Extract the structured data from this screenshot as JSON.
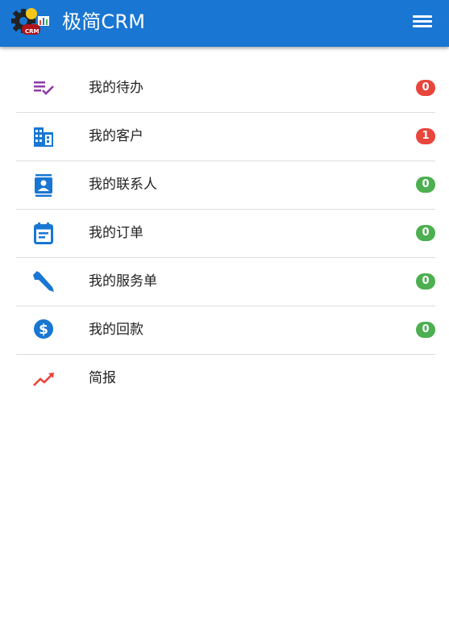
{
  "header": {
    "title": "极简CRM",
    "logo_text": "CRM",
    "menu_icon": "hamburger-menu-icon"
  },
  "colors": {
    "appbar": "#1976d2",
    "badge_red": "#e8453c",
    "badge_green": "#4caf50",
    "icon_blue": "#1976d2",
    "icon_purple": "#8e3aa8",
    "icon_red": "#e8453c"
  },
  "menu": {
    "items": [
      {
        "label": "我的待办",
        "icon": "playlist-check-icon",
        "badge": "0",
        "badge_color": "#e8453c"
      },
      {
        "label": "我的客户",
        "icon": "domain-building-icon",
        "badge": "1",
        "badge_color": "#e8453c"
      },
      {
        "label": "我的联系人",
        "icon": "contact-card-icon",
        "badge": "0",
        "badge_color": "#4caf50"
      },
      {
        "label": "我的订单",
        "icon": "calendar-order-icon",
        "badge": "0",
        "badge_color": "#4caf50"
      },
      {
        "label": "我的服务单",
        "icon": "wrench-icon",
        "badge": "0",
        "badge_color": "#4caf50"
      },
      {
        "label": "我的回款",
        "icon": "dollar-coin-icon",
        "badge": "0",
        "badge_color": "#4caf50"
      },
      {
        "label": "简报",
        "icon": "trending-up-icon"
      }
    ]
  }
}
